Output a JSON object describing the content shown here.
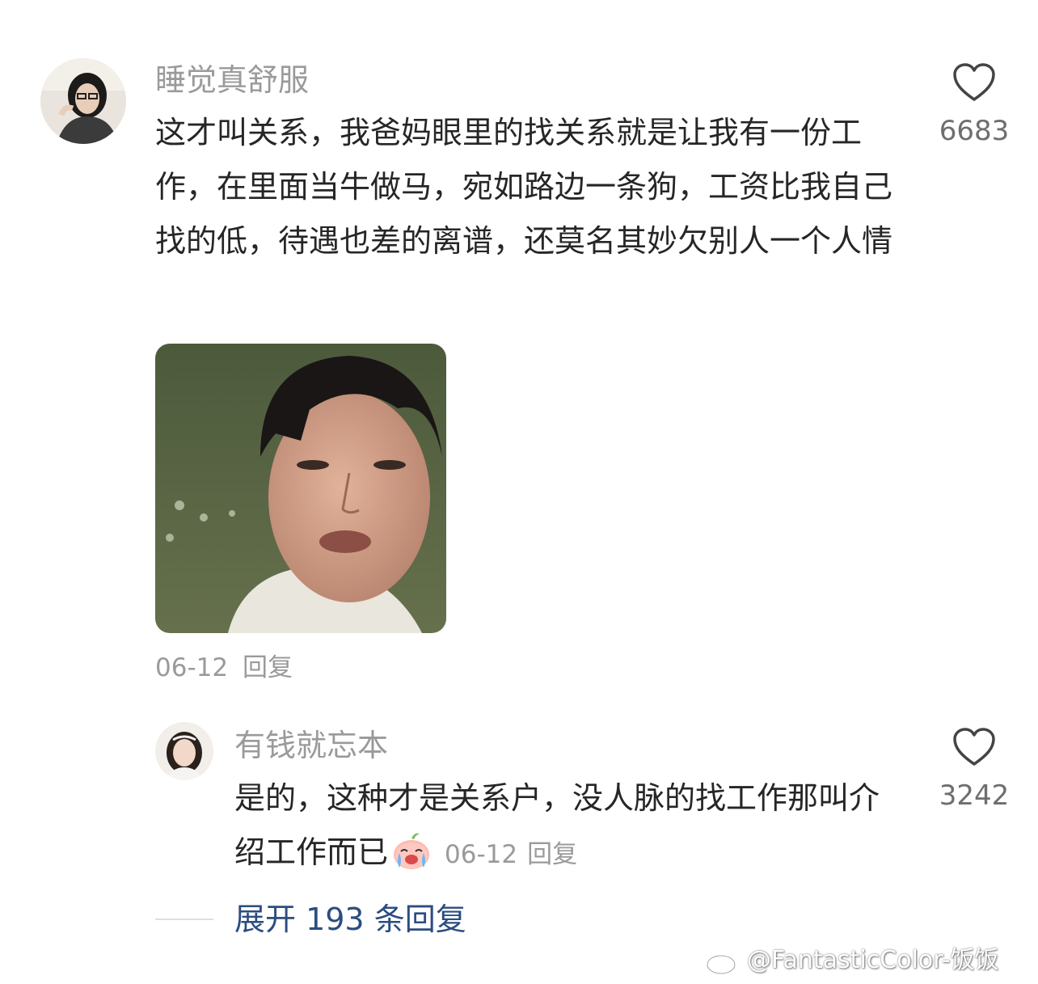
{
  "comment": {
    "username": "睡觉真舒服",
    "text": "这才叫关系，我爸妈眼里的找关系就是让我有一份工作，在里面当牛做马，宛如路边一条狗，工资比我自己找的低，待遇也差的离谱，还莫名其妙欠别人一个人情",
    "like_count": "6683",
    "date": "06-12",
    "reply_label": "回复",
    "icons": {
      "like": "heart-outline-icon",
      "attached_image": "meme-face-image"
    }
  },
  "reply": {
    "username": "有钱就忘本",
    "text": "是的，这种才是关系户，没人脉的找工作那叫介绍工作而已",
    "emoji": "crying-peach-emoji",
    "like_count": "3242",
    "date": "06-12",
    "reply_label": "回复"
  },
  "expand_replies": {
    "label": "展开 193 条回复"
  },
  "watermark": {
    "text": "@FantasticColor-饭饭",
    "icon": "weibo-logo-icon"
  },
  "colors": {
    "username": "#9a9a9a",
    "link": "#2b4d80",
    "body": "#262626"
  }
}
